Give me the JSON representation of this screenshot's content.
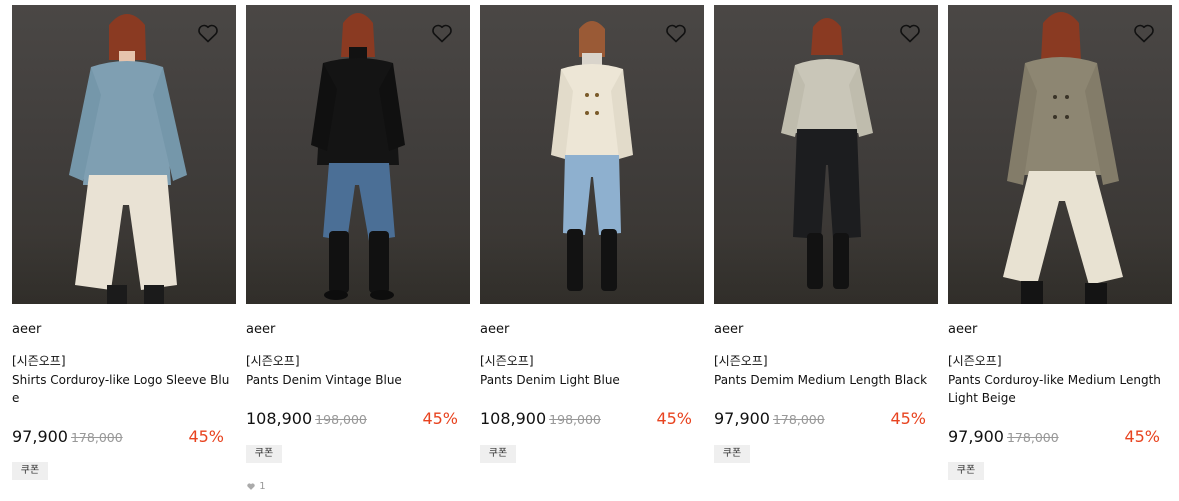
{
  "products": [
    {
      "brand": "aeer",
      "tag": "[시즌오프]",
      "name": "Shirts Corduroy-like Logo Sleeve Blue",
      "price": "97,900",
      "original": "178,000",
      "discount": "45%",
      "coupon": "쿠폰"
    },
    {
      "brand": "aeer",
      "tag": "[시즌오프]",
      "name": "Pants Denim Vintage Blue",
      "price": "108,900",
      "original": "198,000",
      "discount": "45%",
      "coupon": "쿠폰",
      "likes": "1"
    },
    {
      "brand": "aeer",
      "tag": "[시즌오프]",
      "name": "Pants Denim Light Blue",
      "price": "108,900",
      "original": "198,000",
      "discount": "45%",
      "coupon": "쿠폰"
    },
    {
      "brand": "aeer",
      "tag": "[시즌오프]",
      "name": "Pants Demim Medium Length Black",
      "price": "97,900",
      "original": "178,000",
      "discount": "45%",
      "coupon": "쿠폰"
    },
    {
      "brand": "aeer",
      "tag": "[시즌오프]",
      "name": "Pants Corduroy-like Medium Length Light Beige",
      "price": "97,900",
      "original": "178,000",
      "discount": "45%",
      "coupon": "쿠폰"
    }
  ],
  "colors": {
    "discount": "#e8431f",
    "background_photo": "#43403d"
  },
  "icons": {
    "wishlist": "heart-outline-icon",
    "likes": "heart-filled-icon"
  }
}
